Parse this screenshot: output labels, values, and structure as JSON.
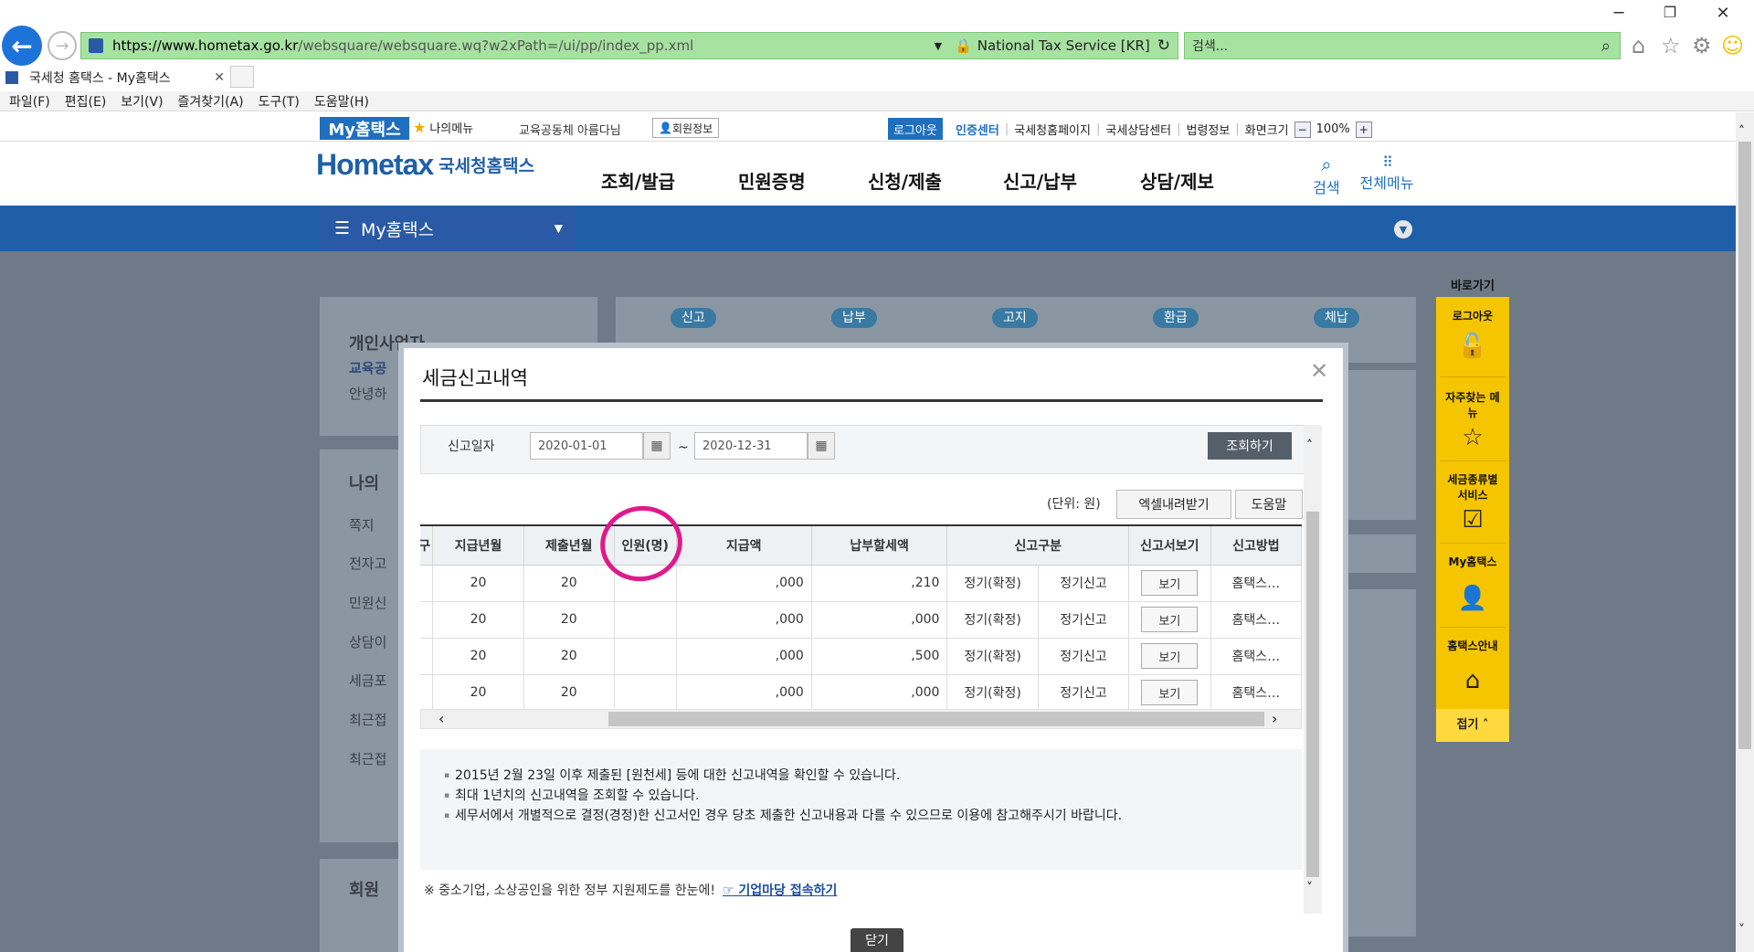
{
  "browser": {
    "url_domain": "https://www.hometax.go.kr",
    "url_path": "/websquare/websquare.wq?w2xPath=/ui/pp/index_pp.xml",
    "cert_label": "National Tax Service [KR]",
    "search_placeholder": "검색...",
    "tab_title": "국세청 홈택스 - My홈택스",
    "menu": [
      "파일(F)",
      "편집(E)",
      "보기(V)",
      "즐겨찾기(A)",
      "도구(T)",
      "도움말(H)"
    ]
  },
  "util": {
    "my_hometax": "My홈택스",
    "my_menu": "나의메뉴",
    "user": "교육공동체 아름다님",
    "user_info": "회원정보",
    "logout": "로그아웃",
    "cert_center": "인증센터",
    "links": [
      "국세청홈페이지",
      "국세상담센터",
      "법령정보",
      "화면크기"
    ],
    "zoom": "100%"
  },
  "gnb": {
    "logo": "Hometax",
    "logo_sub": "국세청홈택스",
    "items": [
      "조회/발급",
      "민원증명",
      "신청/제출",
      "신고/납부",
      "상담/제보"
    ],
    "search": "검색",
    "all_menu": "전체메뉴"
  },
  "subbar": {
    "title": "My홈택스"
  },
  "background": {
    "left_title": "개인사업자",
    "left_sub": "교육공",
    "left_hello": "안녕하",
    "my_title": "나의",
    "my_items": [
      "쪽지",
      "전자고",
      "민원신",
      "상담이",
      "세금포",
      "최근접",
      "최근접"
    ],
    "member": "회원",
    "tabs": [
      "신고",
      "납부",
      "고지",
      "환급",
      "체납"
    ]
  },
  "quick": {
    "title": "바로가기",
    "items": [
      {
        "label": "로그아웃",
        "icon": "unlock-icon"
      },
      {
        "label": "자주찾는 메뉴",
        "icon": "star-icon"
      },
      {
        "label": "세금종류별 서비스",
        "icon": "check-icon"
      },
      {
        "label": "My홈택스",
        "icon": "person-icon"
      },
      {
        "label": "홈택스안내",
        "icon": "home-icon"
      }
    ],
    "close": "접기"
  },
  "modal": {
    "title": "세금신고내역",
    "date_label": "신고일자",
    "date_from": "2020-01-01",
    "date_to": "2020-12-31",
    "query": "조회하기",
    "unit": "(단위: 원)",
    "excel": "엑셀내려받기",
    "help": "도움말",
    "columns": [
      "구",
      "지급년월",
      "제출년월",
      "인원(명)",
      "지급액",
      "납부할세액",
      "신고구분",
      "",
      "신고서보기",
      "신고방법"
    ],
    "rows": [
      {
        "pay_ym": "20",
        "submit_ym": "20",
        "people": "",
        "amount": ",000",
        "tax": ",210",
        "type1": "정기(확정)",
        "type2": "정기신고",
        "view": "보기",
        "method": "홈택스…"
      },
      {
        "pay_ym": "20",
        "submit_ym": "20",
        "people": "",
        "amount": ",000",
        "tax": ",000",
        "type1": "정기(확정)",
        "type2": "정기신고",
        "view": "보기",
        "method": "홈택스…"
      },
      {
        "pay_ym": "20",
        "submit_ym": "20",
        "people": "",
        "amount": ",000",
        "tax": ",500",
        "type1": "정기(확정)",
        "type2": "정기신고",
        "view": "보기",
        "method": "홈택스…"
      },
      {
        "pay_ym": "20",
        "submit_ym": "20",
        "people": "",
        "amount": ",000",
        "tax": ",000",
        "type1": "정기(확정)",
        "type2": "정기신고",
        "view": "보기",
        "method": "홈택스…"
      }
    ],
    "notes": [
      "2015년 2월 23일 이후 제출된 [원천세] 등에 대한 신고내역을 확인할 수 있습니다.",
      "최대 1년치의 신고내역을 조회할 수 있습니다.",
      "세무서에서 개별적으로 결정(경정)한 신고서인 경우 당초 제출한 신고내용과 다를 수 있으므로 이용에 참고해주시기 바랍니다."
    ],
    "footer_text": "※ 중소기업, 소상공인을 위한 정부 지원제도를 한눈에!",
    "footer_link": "기업마당 접속하기",
    "close": "닫기"
  },
  "colors": {
    "accent": "#1f5fa8",
    "highlight": "#e0198a",
    "quick_bar": "#f5c500"
  }
}
